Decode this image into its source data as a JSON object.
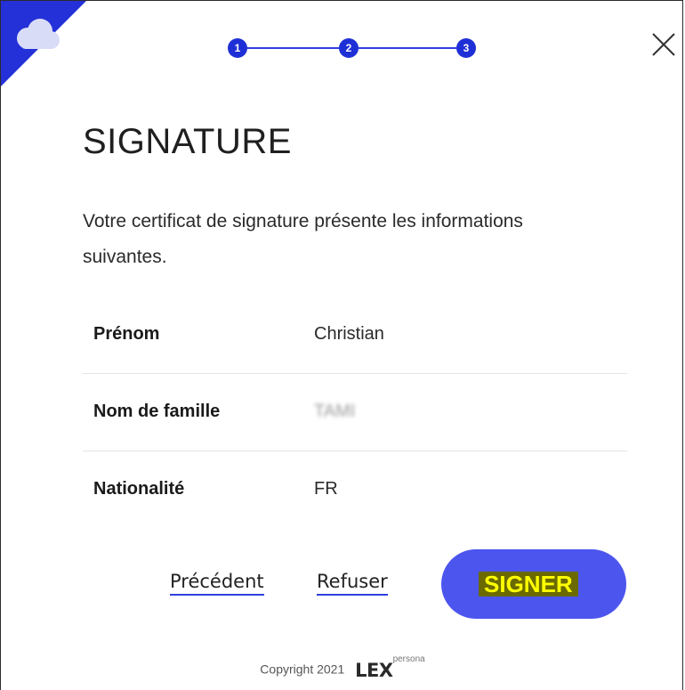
{
  "colors": {
    "accent": "#4c55ee",
    "step": "#1f2fd6",
    "highlight_bg": "#6b6a00",
    "highlight_text": "#ffff00"
  },
  "corner": {
    "icon": "cloud-icon"
  },
  "close": {
    "icon": "close-icon"
  },
  "stepper": {
    "steps": [
      "1",
      "2",
      "3"
    ]
  },
  "title": "SIGNATURE",
  "intro": "Votre certificat de signature présente les informations suivantes.",
  "info": [
    {
      "label": "Prénom",
      "value": "Christian"
    },
    {
      "label": "Nom de famille",
      "value": "TAMI"
    },
    {
      "label": "Nationalité",
      "value": "FR"
    }
  ],
  "actions": {
    "previous_label": "Précédent",
    "refuse_label": "Refuser",
    "sign_label": "SIGNER"
  },
  "footer": {
    "copyright": "Copyright 2021",
    "logo_main": "LEX",
    "logo_sup": "persona"
  }
}
